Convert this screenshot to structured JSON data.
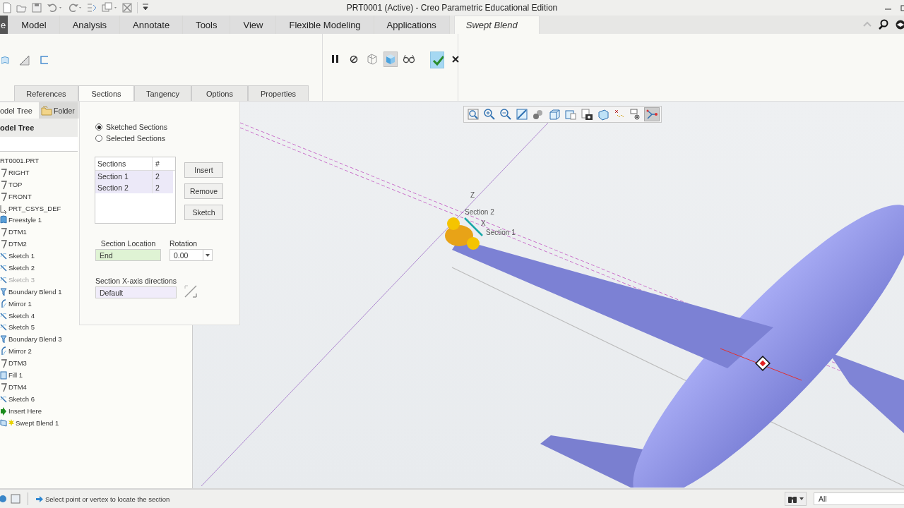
{
  "title_bar": {
    "title": "PRT0001 (Active) - Creo Parametric Educational Edition"
  },
  "ribbon_tabs": [
    {
      "label": "e",
      "kind": "file",
      "selected": false
    },
    {
      "label": "Model",
      "kind": "tab",
      "selected": false
    },
    {
      "label": "Analysis",
      "kind": "tab",
      "selected": false
    },
    {
      "label": "Annotate",
      "kind": "tab",
      "selected": false
    },
    {
      "label": "Tools",
      "kind": "tab",
      "selected": false
    },
    {
      "label": "View",
      "kind": "tab",
      "selected": false
    },
    {
      "label": "Flexible Modeling",
      "kind": "tab",
      "selected": false
    },
    {
      "label": "Applications",
      "kind": "tab",
      "selected": false
    },
    {
      "label": "Swept Blend",
      "kind": "feature",
      "selected": true
    }
  ],
  "dashboard": {
    "tools": [
      {
        "kind": "pause",
        "on": false
      },
      {
        "kind": "stop",
        "on": false
      },
      {
        "kind": "preview-frame",
        "on": false
      },
      {
        "kind": "preview-solid",
        "on": true
      },
      {
        "kind": "glasses",
        "on": false
      },
      {
        "kind": "ok",
        "on": false
      },
      {
        "kind": "cancel",
        "on": false
      }
    ],
    "tabs": [
      {
        "label": "References",
        "selected": false
      },
      {
        "label": "Sections",
        "selected": true
      },
      {
        "label": "Tangency",
        "selected": false
      },
      {
        "label": "Options",
        "selected": false
      },
      {
        "label": "Properties",
        "selected": false
      }
    ]
  },
  "tree_tabs": [
    {
      "label": "odel Tree",
      "kind": "tree",
      "selected": true
    },
    {
      "label": "Folder",
      "kind": "folder",
      "selected": false
    }
  ],
  "tree_header": "odel Tree",
  "tree": [
    {
      "label": "RT0001.PRT",
      "disabled": false,
      "children": [
        {
          "label": "RIGHT",
          "kind": "datum",
          "disabled": false
        },
        {
          "label": "TOP",
          "kind": "datum",
          "disabled": false
        },
        {
          "label": "FRONT",
          "kind": "datum",
          "disabled": false
        },
        {
          "label": "PRT_CSYS_DEF",
          "kind": "csys",
          "disabled": false
        },
        {
          "label": "Freestyle 1",
          "kind": "freestyle",
          "disabled": false
        },
        {
          "label": "DTM1",
          "kind": "datum",
          "disabled": false
        },
        {
          "label": "DTM2",
          "kind": "datum",
          "disabled": false
        },
        {
          "label": "Sketch 1",
          "kind": "sketch",
          "disabled": false
        },
        {
          "label": "Sketch 2",
          "kind": "sketch",
          "disabled": false
        },
        {
          "label": "Sketch 3",
          "kind": "sketch",
          "disabled": true
        },
        {
          "label": "Boundary Blend 1",
          "kind": "blend",
          "disabled": false
        },
        {
          "label": "Mirror 1",
          "kind": "mirror",
          "disabled": false
        },
        {
          "label": "Sketch 4",
          "kind": "sketch",
          "disabled": false
        },
        {
          "label": "Sketch 5",
          "kind": "sketch",
          "disabled": false
        },
        {
          "label": "Boundary Blend 3",
          "kind": "blend",
          "disabled": false
        },
        {
          "label": "Mirror 2",
          "kind": "mirror",
          "disabled": false
        },
        {
          "label": "DTM3",
          "kind": "datum",
          "disabled": false
        },
        {
          "label": "Fill 1",
          "kind": "fill",
          "disabled": false
        },
        {
          "label": "DTM4",
          "kind": "datum",
          "disabled": false
        },
        {
          "label": "Sketch 6",
          "kind": "sketch",
          "disabled": false
        },
        {
          "label": "Insert Here",
          "kind": "insert",
          "disabled": false
        },
        {
          "label": "Swept Blend 1",
          "kind": "swept",
          "disabled": false
        }
      ]
    }
  ],
  "sections_panel": {
    "options": [
      {
        "label": "Sketched Sections",
        "selected": true
      },
      {
        "label": "Selected Sections",
        "selected": false
      }
    ],
    "table": {
      "columns": [
        "Sections",
        "#"
      ],
      "rows": [
        {
          "cells": [
            "Section 1",
            "2"
          ],
          "selected": true
        },
        {
          "cells": [
            "Section 2",
            "2"
          ],
          "selected": true
        }
      ]
    },
    "buttons": [
      "Insert",
      "Remove",
      "Sketch"
    ],
    "section_location": {
      "label": "Section Location",
      "value": "End"
    },
    "rotation": {
      "label": "Rotation",
      "value": "0.00"
    },
    "x_axis": {
      "label": "Section X-axis directions",
      "value": "Default"
    }
  },
  "viewport": {
    "tools": [
      {
        "kind": "zoom-fit",
        "on": false
      },
      {
        "kind": "zoom-in",
        "on": false
      },
      {
        "kind": "zoom-out",
        "on": false
      },
      {
        "kind": "repaint",
        "on": false
      },
      {
        "kind": "display-style",
        "on": false
      },
      {
        "kind": "saved-views",
        "on": false
      },
      {
        "kind": "view-manager",
        "on": false
      },
      {
        "kind": "snapshot",
        "on": false
      },
      {
        "kind": "perspective",
        "on": false
      },
      {
        "kind": "datum-display",
        "on": false
      },
      {
        "kind": "annotation-display",
        "on": false
      },
      {
        "kind": "spin-center",
        "on": true
      }
    ],
    "labels": [
      "Z",
      "Section 2",
      "X",
      "Section 1"
    ]
  },
  "status_bar": {
    "message": "Select point or vertex to locate the section",
    "filter": "All"
  }
}
